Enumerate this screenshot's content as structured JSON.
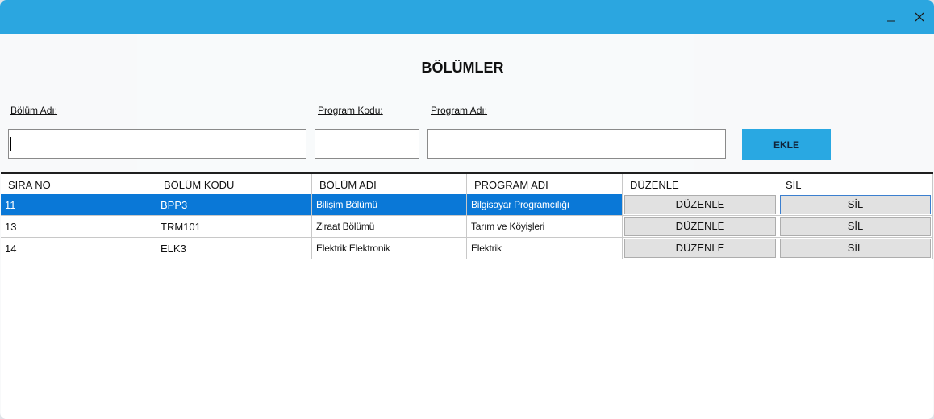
{
  "window": {
    "minimize_glyph": "_",
    "close_glyph": "✕"
  },
  "title": "BÖLÜMLER",
  "form": {
    "bolum_adi_label": "Bölüm Adı:",
    "program_kodu_label": "Program Kodu:",
    "program_adi_label": "Program Adı:",
    "bolum_adi_value": "",
    "program_kodu_value": "",
    "program_adi_value": "",
    "add_button_label": "EKLE"
  },
  "table": {
    "columns": [
      "SIRA NO",
      "BÖLÜM KODU",
      "BÖLÜM ADI",
      "PROGRAM ADI",
      "DÜZENLE",
      "SİL"
    ],
    "rows": [
      {
        "sira_no": "11",
        "bolum_kodu": "BPP3",
        "bolum_adi": "Bilişim Bölümü",
        "program_adi": "Bilgisayar Programcılığı",
        "edit_label": "DÜZENLE",
        "delete_label": "SİL",
        "selected": true
      },
      {
        "sira_no": "13",
        "bolum_kodu": "TRM101",
        "bolum_adi": "Ziraat Bölümü",
        "program_adi": "Tarım ve Köyişleri",
        "edit_label": "DÜZENLE",
        "delete_label": "SİL",
        "selected": false
      },
      {
        "sira_no": "14",
        "bolum_kodu": "ELK3",
        "bolum_adi": "Elektrik Elektronik",
        "program_adi": "Elektrik",
        "edit_label": "DÜZENLE",
        "delete_label": "SİL",
        "selected": false
      }
    ]
  },
  "colors": {
    "titlebar": "#2ba6e0",
    "accent_button": "#29a8e2",
    "selection": "#0a78d7"
  }
}
